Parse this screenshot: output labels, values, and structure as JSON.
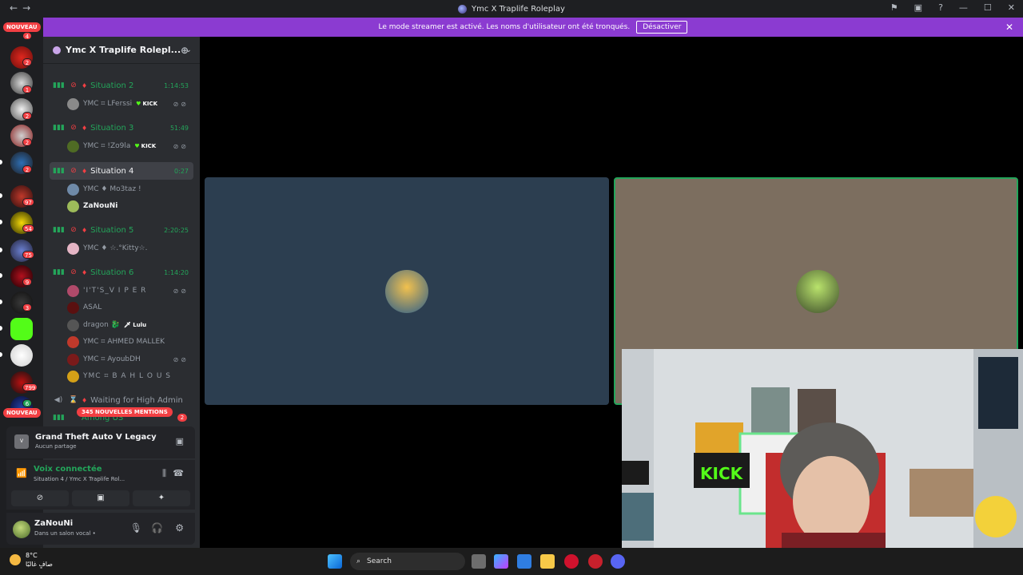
{
  "window": {
    "title": "Ymc X Traplife Roleplay",
    "nav_back": "←",
    "nav_forward": "→"
  },
  "banner": {
    "message": "Le mode streamer est activé. Les noms d'utilisateur ont été tronqués.",
    "button": "Désactiver",
    "close": "✕"
  },
  "servers": {
    "new_top": "NOUVEAU",
    "new_bottom": "NOUVEAU",
    "badges": [
      "4",
      "2",
      "1",
      "2",
      "2",
      "2",
      "97",
      "54",
      "75",
      "9",
      "3",
      "799",
      "6"
    ]
  },
  "server_header": {
    "name": "Ymc X Traplife Rolepl...",
    "chevron": "⌄"
  },
  "channels": [
    {
      "name": "Situation 2",
      "time": "1:14:53"
    },
    {
      "name": "Situation 3",
      "time": "51:49"
    },
    {
      "name": "Situation 4",
      "time": "0:27"
    },
    {
      "name": "Situation 5",
      "time": "2:20:25"
    },
    {
      "name": "Situation 6",
      "time": "1:14:20"
    },
    {
      "name": "Waiting for High Admin",
      "time": ""
    },
    {
      "name": "Among US",
      "time": ""
    }
  ],
  "users": {
    "s2": [
      {
        "name": "YMC ⌗ LFerssi",
        "tag": "KICK"
      }
    ],
    "s3": [
      {
        "name": "YMC ⌗ !Zo9la",
        "tag": "KICK"
      }
    ],
    "s4": [
      {
        "name": "YMC ♦ Mo3taz !"
      },
      {
        "name": "ZaNouNi"
      }
    ],
    "s5": [
      {
        "name": "YMC ♦ ☆.°Kitty☆."
      }
    ],
    "s6": [
      {
        "name": "'I'T'S_V I P E R"
      },
      {
        "name": "ASAL"
      },
      {
        "name": "dragon 🐉",
        "tag": "🗡 Lulu"
      },
      {
        "name": "YMC ⌗ AHMED MALLEK"
      },
      {
        "name": "YMC ⌗ AyoubDH"
      },
      {
        "name": "YMC ⌗ B A H L O U S"
      }
    ]
  },
  "mentions": "345 NOUVELLES MENTIONS",
  "among_us_badge": "2",
  "game_panel": {
    "title": "Grand Theft Auto V Legacy",
    "subtitle": "Aucun partage"
  },
  "voice_panel": {
    "status": "Voix connectée",
    "channel": "Situation 4 / Ymc X Traplife Rol..."
  },
  "me": {
    "name": "ZaNouNi",
    "status": "Dans un salon vocal •"
  },
  "taskbar": {
    "temperature": "8°C",
    "weather": "صافٍ غالبًا",
    "search": "Search"
  },
  "colors": {
    "banner": "#8b3bd1",
    "voice_green": "#23a55a",
    "tile_left": "#2c3e50",
    "tile_right": "#7c6e5f"
  }
}
